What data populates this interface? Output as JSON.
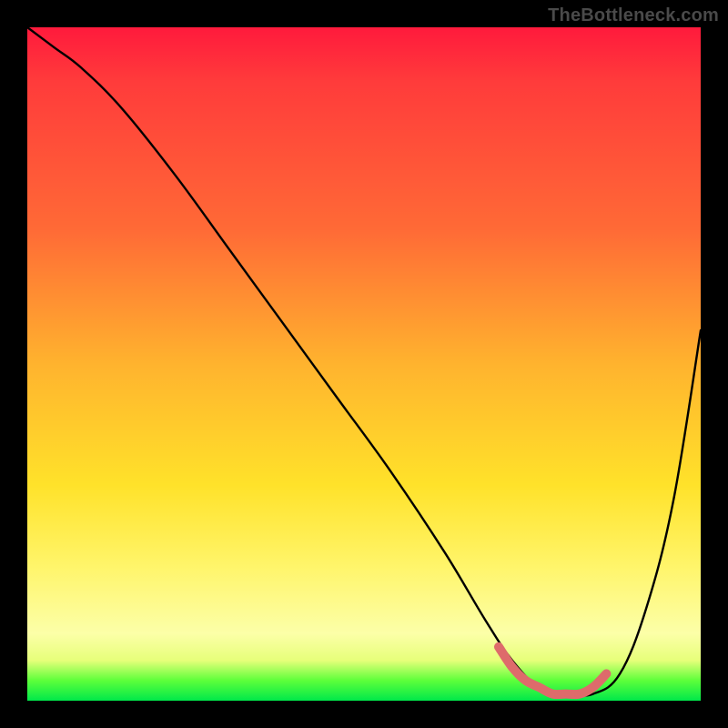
{
  "watermark": "TheBottleneck.com",
  "chart_data": {
    "type": "line",
    "title": "",
    "xlabel": "",
    "ylabel": "",
    "xlim": [
      0,
      100
    ],
    "ylim": [
      0,
      100
    ],
    "legend": false,
    "grid": false,
    "annotations": [],
    "series": [
      {
        "name": "curve",
        "color": "#000000",
        "x": [
          0,
          4,
          8,
          14,
          22,
          30,
          38,
          46,
          54,
          62,
          68,
          72,
          76,
          80,
          84,
          88,
          92,
          96,
          100
        ],
        "y": [
          100,
          97,
          94,
          88,
          78,
          67,
          56,
          45,
          34,
          22,
          12,
          6,
          2,
          1,
          1,
          4,
          14,
          30,
          55
        ]
      },
      {
        "name": "valley-highlight",
        "color": "#de6b6b",
        "x": [
          70,
          72,
          74,
          76,
          78,
          80,
          82,
          84,
          86
        ],
        "y": [
          8,
          5,
          3,
          2,
          1,
          1,
          1,
          2,
          4
        ]
      }
    ]
  }
}
